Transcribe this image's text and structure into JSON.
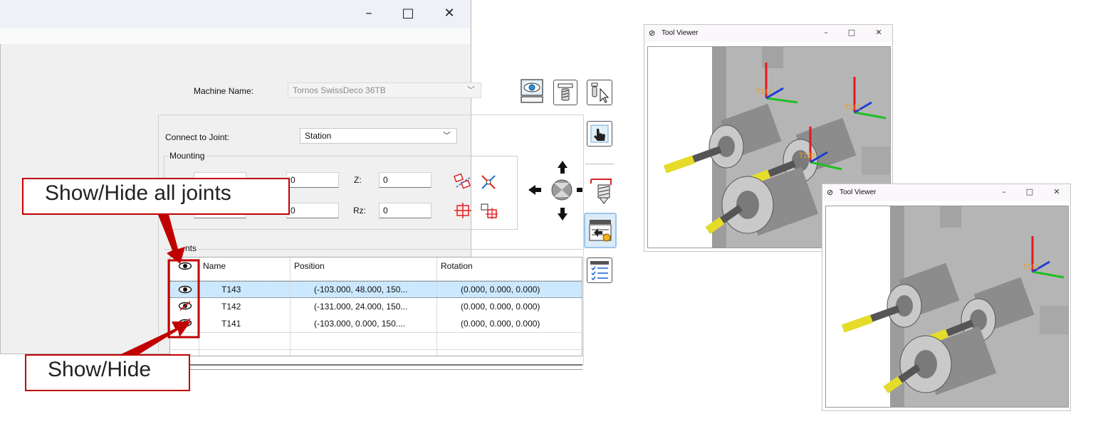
{
  "window": {
    "minimize_icon": "–",
    "maximize_icon": "□",
    "close_icon": "✕"
  },
  "machine": {
    "label": "Machine Name:",
    "value": "Tornos SwissDeco 36TB"
  },
  "connect": {
    "label": "Connect to Joint:",
    "value": "Station"
  },
  "mounting": {
    "legend": "Mounting",
    "x_value": "0",
    "rx_value": "0",
    "z_label": "Z:",
    "z_value": "0",
    "rz_label": "Rz:",
    "rz_value": "0"
  },
  "joints": {
    "legend_visible": "nts",
    "columns": [
      "Name",
      "Position",
      "Rotation"
    ],
    "rows": [
      {
        "name": "T143",
        "position": "(-103.000, 48.000, 150...",
        "rotation": "(0.000, 0.000, 0.000)",
        "visible": true,
        "selected": true
      },
      {
        "name": "T142",
        "position": "(-131.000, 24.000, 150...",
        "rotation": "(0.000, 0.000, 0.000)",
        "visible": false,
        "selected": false
      },
      {
        "name": "T141",
        "position": "(-103.000, 0.000, 150....",
        "rotation": "(0.000, 0.000, 0.000)",
        "visible": false,
        "selected": false
      }
    ]
  },
  "callouts": {
    "all_joints": "Show/Hide all joints",
    "single": "Show/Hide"
  },
  "viewer1": {
    "title": "Tool Viewer",
    "labels": [
      "T141",
      "T142",
      "T143"
    ]
  },
  "viewer2": {
    "title": "Tool Viewer",
    "labels": [
      "T142"
    ]
  },
  "colors": {
    "callout_border": "#c00000",
    "selection": "#cce8ff",
    "axis_x": "#e01b1b",
    "axis_y": "#1fbf1f",
    "axis_z": "#1a3fd6",
    "tool_tip": "#e5dc2a"
  },
  "icons": [
    "eye-visible-icon",
    "eye-hidden-icon",
    "view-toggle-icon",
    "tool-properties-icon",
    "select-cursor-icon",
    "pointer-hand-icon",
    "move-arrows-icon",
    "drill-tool-icon",
    "joint-edit-icon",
    "checklist-icon"
  ]
}
